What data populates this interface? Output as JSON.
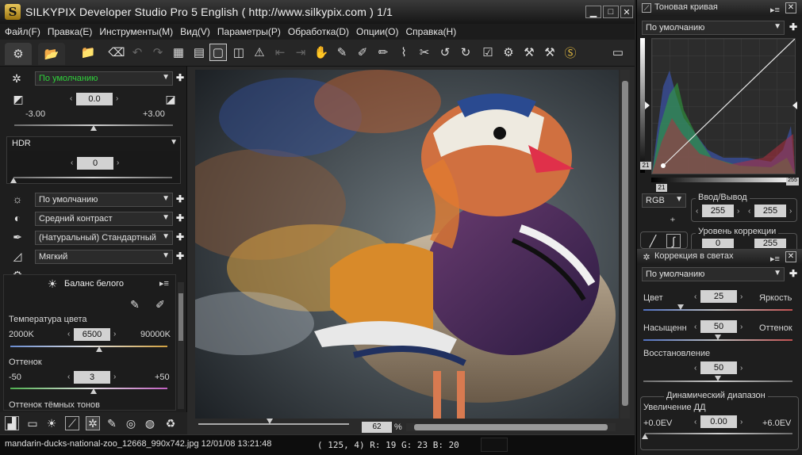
{
  "app": {
    "logo_letter": "S",
    "title": "SILKYPIX Developer Studio Pro 5 English ( http://www.silkypix.com )   1/1"
  },
  "menu": [
    "Файл(F)",
    "Правка(E)",
    "Инструменты(M)",
    "Вид(V)",
    "Параметры(P)",
    "Обработка(D)",
    "Опции(O)",
    "Справка(H)"
  ],
  "left_panel": {
    "preset_combo": "По умолчанию",
    "exposure": {
      "value": "0.0",
      "min_label": "-3.00",
      "max_label": "+3.00",
      "level": 0.5
    },
    "hdr": {
      "combo": "HDR",
      "value": "0",
      "level": 0.0
    },
    "combos": [
      "По умолчанию",
      "Средний контраст",
      "(Натуральный) Стандартный",
      "Мягкий"
    ],
    "white_balance": {
      "title": "Баланс белого",
      "temp_label": "Температура цвета",
      "temp_min": "2000K",
      "temp_value": "6500",
      "temp_max": "90000K",
      "temp_level": 0.565,
      "tint_label": "Оттенок",
      "tint_min": "-50",
      "tint_value": "3",
      "tint_max": "+50",
      "tint_level": 0.53,
      "next_label": "Оттенок тёмных тонов"
    }
  },
  "viewer": {
    "zoom": "62",
    "zoom_unit": "%"
  },
  "status": {
    "file": "mandarin-ducks-national-zoo_12668_990x742.jpg 12/01/08 13:21:48",
    "pixel": "( 125,   4) R: 19 G: 23 B: 20"
  },
  "tone_curve": {
    "title": "Тоновая кривая",
    "preset": "По умолчанию",
    "black_point": "21",
    "white_point": "255",
    "channel": "RGB",
    "io_legend": "Ввод/Вывод",
    "input": "255",
    "output": "255",
    "correction_legend": "Уровень коррекции",
    "corr_in": "0",
    "corr_out": "255"
  },
  "highlight": {
    "title": "Коррекция в светах",
    "preset": "По умолчанию",
    "color_label": "Цвет",
    "color_value": "25",
    "brightness_label": "Яркость",
    "color_level": 0.25,
    "saturation_label": "Насыщенн",
    "saturation_value": "50",
    "hue_label": "Оттенок",
    "saturation_level": 0.5,
    "recovery_label": "Восстановление",
    "recovery_value": "50",
    "recovery_level": 0.5,
    "dr_legend": "Динамический диапазон",
    "dr_label": "Увеличение ДД",
    "dr_min": "+0.0EV",
    "dr_value": "0.00",
    "dr_max": "+6.0EV",
    "dr_level": 0.0
  },
  "colors": {
    "accent_green": "#2fd13b",
    "panel_bg": "#1e1e1e"
  }
}
